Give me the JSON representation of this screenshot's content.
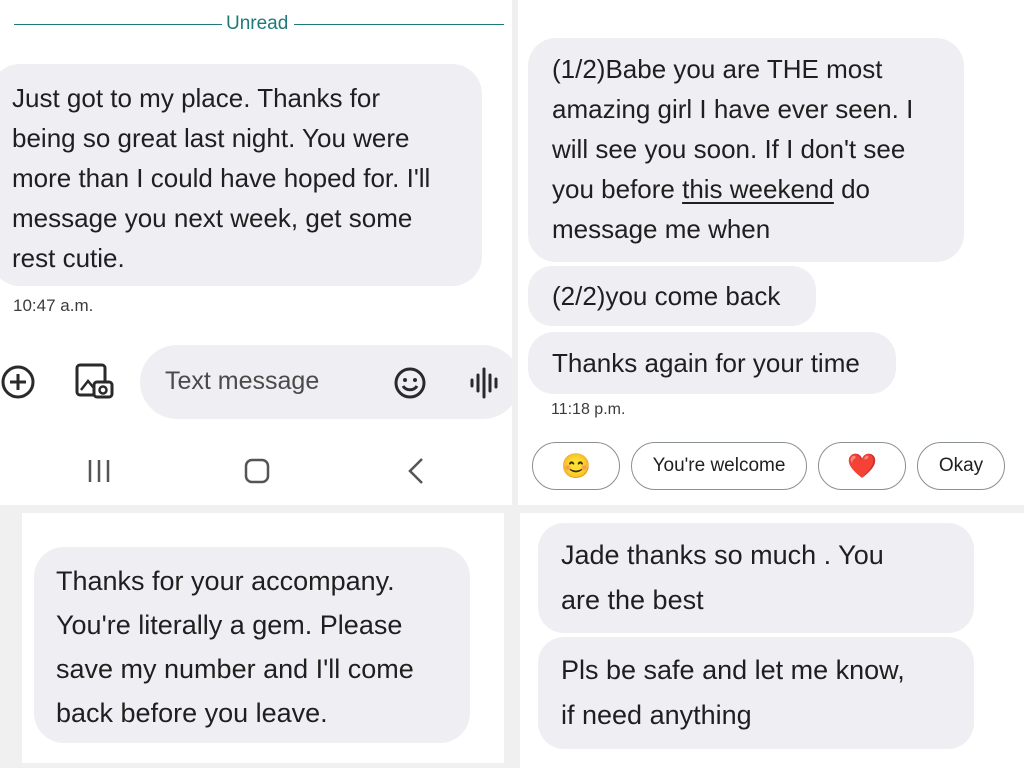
{
  "panel_tl": {
    "divider_label": "Unread",
    "message": "Just got to my place. Thanks for being so great last night. You were more than I could have hoped for. I'll message you next week, get some rest cutie.",
    "message_lines": [
      "Just got to my place. Thanks for",
      "being so great last night. You were",
      "more than I could have hoped for. I'll",
      "message you next week, get some",
      "rest cutie."
    ],
    "timestamp": "10:47 a.m.",
    "compose_placeholder": "Text message",
    "icons": [
      "add-icon",
      "gallery-icon",
      "emoji-icon",
      "voice-icon"
    ],
    "nav_icons": [
      "recents-icon",
      "home-icon",
      "back-icon"
    ]
  },
  "panel_tr": {
    "messages": [
      {
        "lines": [
          "(1/2)Babe you are THE most",
          "amazing girl I have ever seen. I",
          "will see you soon. If I don't see"
        ],
        "line4_before": "you before ",
        "line4_link": "this weekend",
        "line4_after": " do",
        "line5": "message me when"
      },
      {
        "text": "(2/2)you come back"
      },
      {
        "text": "Thanks again for your time"
      }
    ],
    "timestamp": "11:18 p.m.",
    "smart_replies": [
      {
        "label": "😊",
        "icon": "smiling-face-emoji"
      },
      {
        "label": "You're welcome"
      },
      {
        "label": "❤️",
        "icon": "red-heart-emoji"
      },
      {
        "label": "Okay"
      }
    ]
  },
  "panel_bl": {
    "message_lines": [
      "Thanks for your accompany.",
      "You're literally a gem. Please",
      "save my number and I'll come",
      "back before you leave."
    ]
  },
  "panel_br": {
    "messages": [
      {
        "lines": [
          "Jade thanks so much . You",
          "are the best"
        ]
      },
      {
        "lines": [
          "Pls be safe and let me know,",
          "if need anything"
        ]
      }
    ]
  }
}
